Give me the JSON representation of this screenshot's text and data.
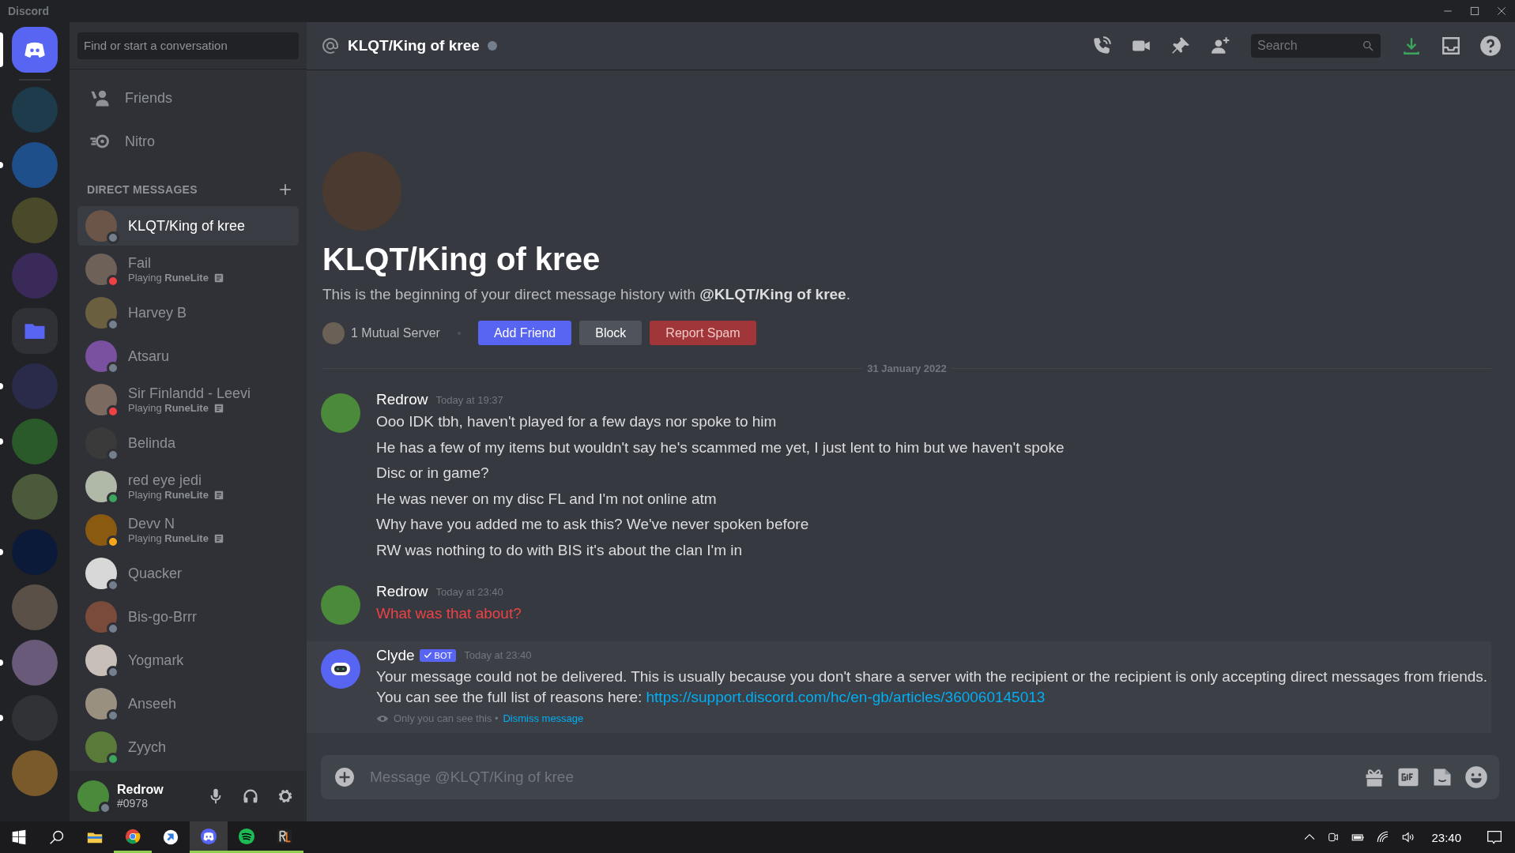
{
  "window": {
    "title": "Discord"
  },
  "servers": [
    {
      "kind": "home",
      "selected": true,
      "unread": false
    },
    {
      "kind": "server",
      "selected": false,
      "unread": false
    },
    {
      "kind": "server",
      "selected": false,
      "unread": true
    },
    {
      "kind": "server",
      "selected": false,
      "unread": false
    },
    {
      "kind": "server",
      "selected": false,
      "unread": false
    },
    {
      "kind": "folder",
      "selected": false,
      "unread": false
    },
    {
      "kind": "server",
      "selected": false,
      "unread": true
    },
    {
      "kind": "server",
      "selected": false,
      "unread": true
    },
    {
      "kind": "server",
      "selected": false,
      "unread": false
    },
    {
      "kind": "server",
      "selected": false,
      "unread": true
    },
    {
      "kind": "server",
      "selected": false,
      "unread": false
    },
    {
      "kind": "server",
      "selected": false,
      "unread": true
    },
    {
      "kind": "server",
      "selected": false,
      "unread": true
    },
    {
      "kind": "server",
      "selected": false,
      "unread": false
    }
  ],
  "sidebar": {
    "search_placeholder": "Find or start a conversation",
    "nav": [
      {
        "kind": "friends",
        "label": "Friends"
      },
      {
        "kind": "nitro",
        "label": "Nitro"
      }
    ],
    "dm_header": "DIRECT MESSAGES",
    "dms": [
      {
        "name": "KLQT/King of kree",
        "color": "#747f8d",
        "selected": true
      },
      {
        "name": "Fail",
        "activity": "Playing **RuneLite**",
        "color": "#ed4245",
        "selected": false
      },
      {
        "name": "Harvey B",
        "color": "#747f8d",
        "selected": false
      },
      {
        "name": "Atsaru",
        "color": "#747f8d",
        "selected": false
      },
      {
        "name": "Sir Finlandd - Leevi",
        "activity": "Playing **RuneLite**",
        "color": "#ed4245",
        "selected": false
      },
      {
        "name": "Belinda",
        "color": "#747f8d",
        "selected": false
      },
      {
        "name": "red eye jedi",
        "activity": "Playing **RuneLite**",
        "color": "#3ba55d",
        "selected": false
      },
      {
        "name": "Devv N",
        "activity": "Playing **RuneLite**",
        "color": "#faa81a",
        "selected": false
      },
      {
        "name": "Quacker",
        "color": "#747f8d",
        "selected": false
      },
      {
        "name": "Bis-go-Brrr",
        "color": "#747f8d",
        "selected": false
      },
      {
        "name": "Yogmark",
        "color": "#747f8d",
        "selected": false
      },
      {
        "name": "Anseeh",
        "color": "#747f8d",
        "selected": false
      },
      {
        "name": "Zyych",
        "color": "#3ba55d",
        "selected": false
      }
    ],
    "user": {
      "name": "Redrow",
      "tag": "#0978",
      "color": "#747f8d"
    }
  },
  "header": {
    "title": "KLQT/King of kree",
    "color": "#747f8d",
    "search_placeholder": "Search"
  },
  "welcome": {
    "title": "KLQT/King of kree",
    "text": "This is the beginning of your direct message history with **@KLQT/King of kree**.",
    "mutual": "1 Mutual Server",
    "buttons": [
      {
        "kind": "primary",
        "label": "Add Friend"
      },
      {
        "kind": "secondary",
        "label": "Block"
      },
      {
        "kind": "danger",
        "label": "Report Spam"
      }
    ]
  },
  "date_divider": "31 January 2022",
  "messages": [
    {
      "author": "Redrow",
      "bot": false,
      "timestamp": "Today at 19:37",
      "ephemeral": false,
      "lines": [
        {
          "text": "Ooo IDK tbh, haven't played for a few days nor spoke to him",
          "failed": false
        },
        {
          "text": "He has a few of my items but wouldn't say he's scammed me yet, I just lent to him but we haven't spoke",
          "failed": false
        },
        {
          "text": "Disc or in game?",
          "failed": false
        },
        {
          "text": "He was never on my disc FL and I'm not online atm",
          "failed": false
        },
        {
          "text": "Why have you added me to ask this? We've never spoken before",
          "failed": false
        },
        {
          "text": "RW was nothing to do with BIS it's about the clan I'm in",
          "failed": false
        }
      ]
    },
    {
      "author": "Redrow",
      "bot": false,
      "timestamp": "Today at 23:40",
      "ephemeral": false,
      "lines": [
        {
          "text": "What was that about?",
          "failed": true
        }
      ]
    },
    {
      "author": "Clyde",
      "bot": true,
      "bot_label": "BOT",
      "timestamp": "Today at 23:40",
      "ephemeral": true,
      "lines": [
        {
          "text": "Your message could not be delivered. This is usually because you don't share a server with the recipient or the recipient is only accepting direct messages from friends. You can see the full list of reasons here: ",
          "link": "https://support.discord.com/hc/en-gb/articles/360060145013",
          "failed": false
        }
      ],
      "note": "Only you can see this •",
      "note_action": "Dismiss message"
    }
  ],
  "composer": {
    "placeholder": "Message @KLQT/King of kree"
  },
  "taskbar": {
    "apps": [
      {
        "kind": "explorer",
        "running": false,
        "active": false
      },
      {
        "kind": "chrome",
        "running": true,
        "active": false
      },
      {
        "kind": "app",
        "running": false,
        "active": false
      },
      {
        "kind": "discord",
        "running": true,
        "active": true
      },
      {
        "kind": "spotify",
        "running": true,
        "active": false
      },
      {
        "kind": "runelite",
        "running": true,
        "active": false
      }
    ],
    "time": "23:40"
  }
}
